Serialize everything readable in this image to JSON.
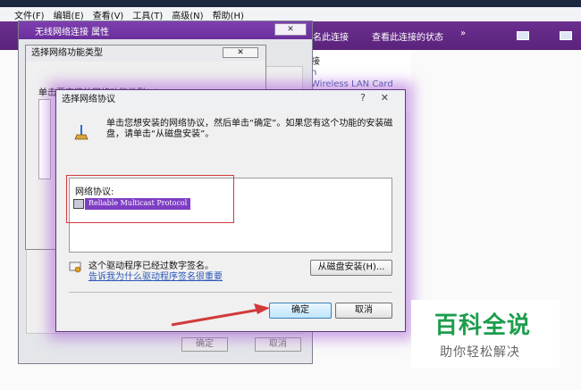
{
  "explorer": {
    "menu": [
      "文件(F)",
      "编辑(E)",
      "查看(V)",
      "工具(T)",
      "高级(N)",
      "帮助(H)"
    ],
    "commands": [
      "名此连接",
      "查看此连接的状态",
      "»"
    ],
    "bg_fragments": [
      "接",
      "n",
      "Wireless LAN Card"
    ]
  },
  "props_window": {
    "title": "无线网络连接 属性",
    "ok": "确定",
    "cancel": "取消"
  },
  "feature_window": {
    "title": "选择网络功能类型",
    "prompt": "单击要安装的网络功能类型(C):"
  },
  "protocol_dialog": {
    "title": "选择网络协议",
    "help": "?",
    "close": "✕",
    "instruction": "单击您想安装的网络协议，然后单击“确定”。如果您有这个功能的安装磁盘，请单击“从磁盘安装”。",
    "list_header": "网络协议:",
    "protocols": [
      "Reliable Multicast Protocol"
    ],
    "signed_text": "这个驱动程序已经过数字签名。",
    "signed_link": "告诉我为什么驱动程序签名很重要",
    "disk_button": "从磁盘安装(H)...",
    "ok_button": "确定",
    "cancel_button": "取消"
  },
  "watermark": {
    "main": "百科全说",
    "sub": "助你轻松解决"
  },
  "colors": {
    "accent_purple": "#7e3ec4",
    "highlight_red": "#d23a3a",
    "watermark_green": "#1d9d4d"
  }
}
